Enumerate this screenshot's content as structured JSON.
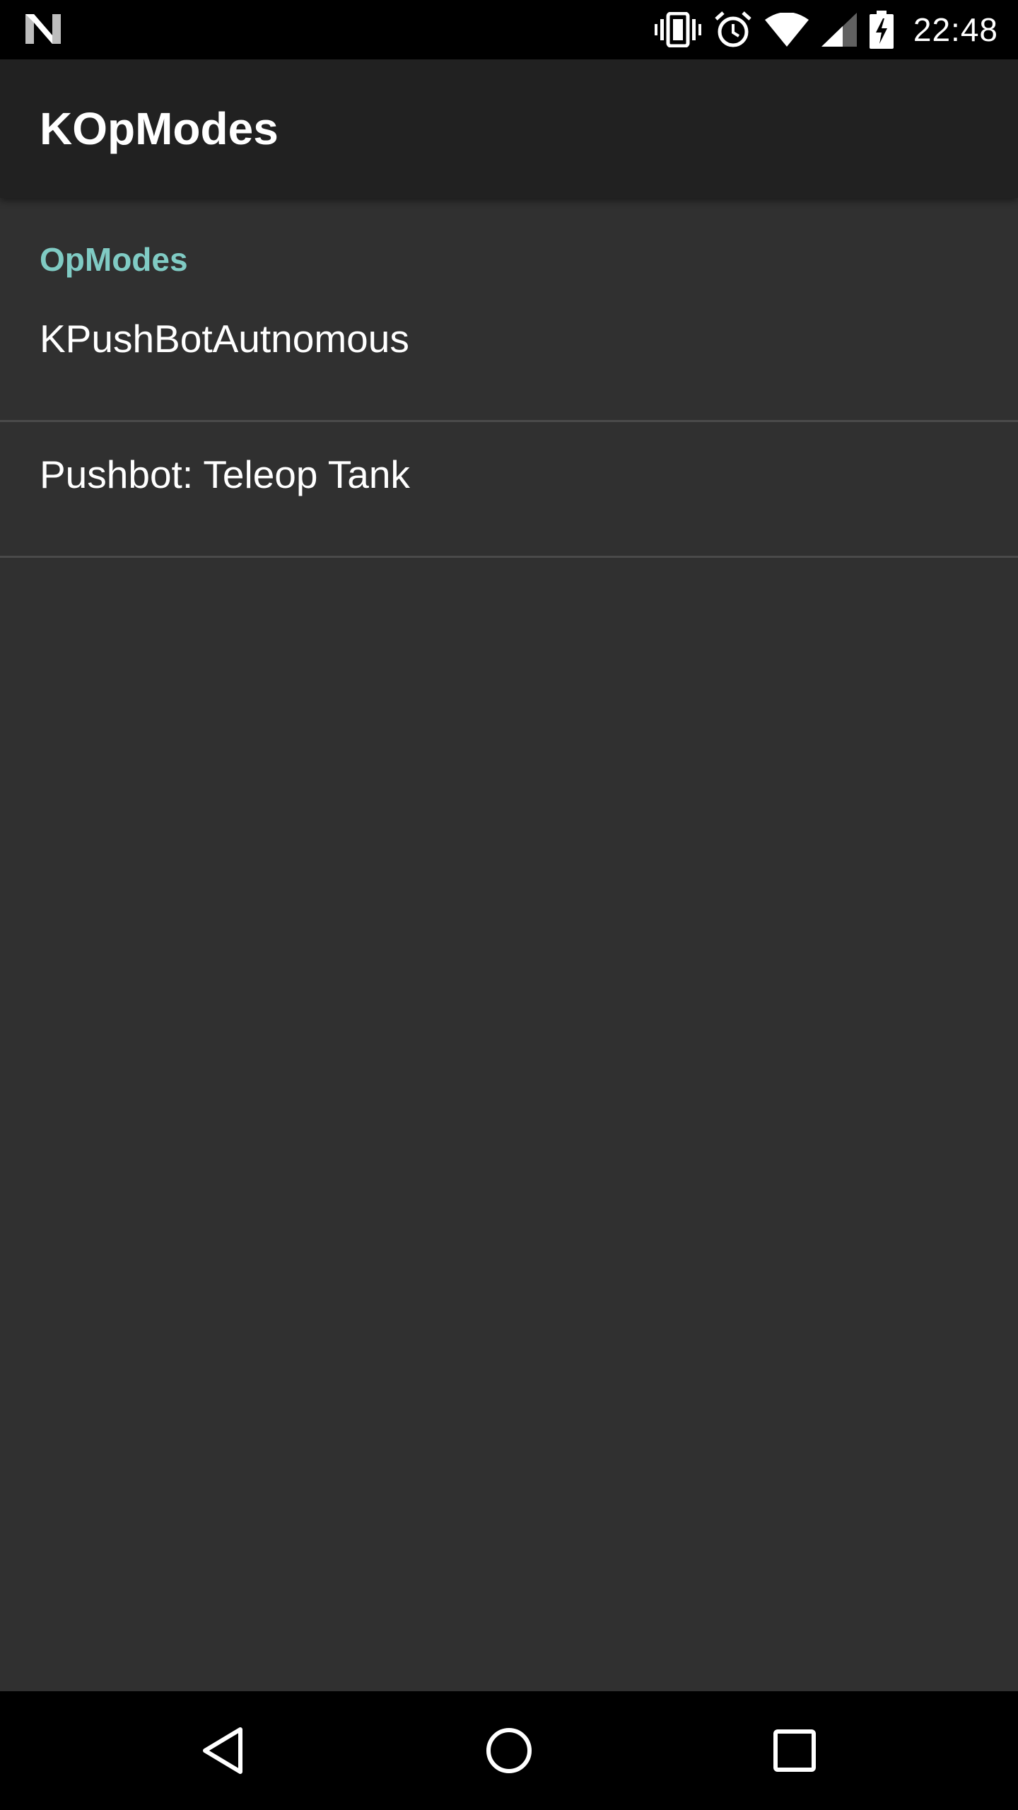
{
  "status_bar": {
    "time": "22:48",
    "icons": [
      "android-n-icon",
      "vibrate-icon",
      "alarm-icon",
      "wifi-icon",
      "cell-signal-icon",
      "battery-charging-icon"
    ]
  },
  "app_bar": {
    "title": "KOpModes"
  },
  "preferences": {
    "category": "OpModes",
    "items": [
      {
        "label": "KPushBotAutnomous"
      },
      {
        "label": "Pushbot: Teleop Tank"
      }
    ]
  },
  "nav_bar": {
    "icons": [
      "back-icon",
      "home-icon",
      "recents-icon"
    ]
  },
  "colors": {
    "background": "#303030",
    "app_bar": "#212121",
    "accent": "#80cbc4",
    "divider": "#4a4a4a"
  }
}
